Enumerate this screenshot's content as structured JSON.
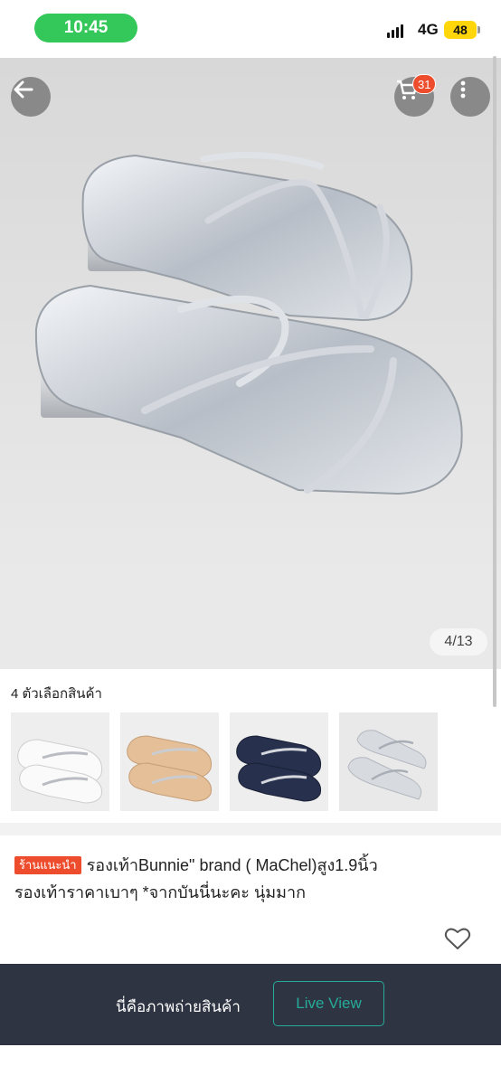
{
  "status_bar": {
    "time": "10:45",
    "network": "4G",
    "battery": "48",
    "colors": {
      "time_pill": "#34c759",
      "battery": "#ffd60a"
    }
  },
  "gallery": {
    "counter": "4/13",
    "cart_badge": "31",
    "icons": {
      "back": "arrow-left-icon",
      "cart": "cart-icon",
      "more": "more-vertical-icon"
    }
  },
  "variants": {
    "title": "4 ตัวเลือกสินค้า",
    "items": [
      {
        "name": "white-variant",
        "tone": "#f4f4f4"
      },
      {
        "name": "beige-variant",
        "tone": "#e6c29e"
      },
      {
        "name": "navy-variant",
        "tone": "#2a3453"
      },
      {
        "name": "silver-variant",
        "tone": "#d9dde2"
      }
    ]
  },
  "product": {
    "badge": "ร้านแนะนำ",
    "title_line1": "รองเท้าBunnie\" brand ( MaChel)สูง1.9นิ้ว",
    "title_line2": "รองเท้าราคาเบาๆ *จากบันนี่นะคะ นุ่มมาก",
    "accent": "#ee4d2d"
  },
  "bottom_bar": {
    "text": "นี่คือภาพถ่ายสินค้า",
    "button": "Live View",
    "button_color": "#26aa99"
  }
}
